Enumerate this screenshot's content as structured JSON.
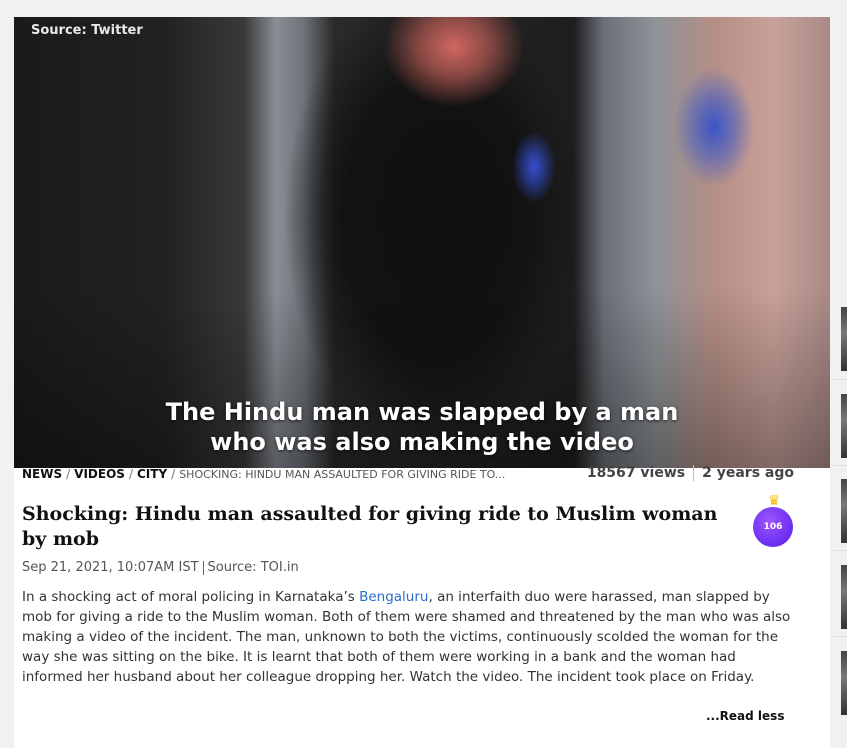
{
  "video": {
    "source_label": "Source: Twitter",
    "caption_line1": "The Hindu man was slapped by a man",
    "caption_line2": "who was also making the video"
  },
  "breadcrumb": {
    "items": [
      "NEWS",
      "VIDEOS",
      "CITY"
    ],
    "separator": "/",
    "current": "SHOCKING: HINDU MAN ASSAULTED FOR GIVING RIDE TO..."
  },
  "stats": {
    "views": "18567 views",
    "age": "2 years ago"
  },
  "article": {
    "title": "Shocking: Hindu man assaulted for giving ride to Muslim woman by mob",
    "badge_count": "106",
    "date": "Sep 21, 2021, 10:07AM IST",
    "source": "Source: TOI.in",
    "body_before_link": "In a shocking act of moral policing in Karnataka’s ",
    "body_link": "Bengaluru",
    "body_after_link": ", an interfaith duo were harassed, man slapped by mob for giving a ride to the Muslim woman. Both of them were shamed and threatened by the man who was also making a video of the incident. The man, unknown to both the victims, continuously scolded the woman for the way she was sitting on the bike. It is learnt that both of them were working in a bank and the woman had informed her husband about her colleague dropping her. Watch the video. The incident took place on Friday.",
    "read_less": "...Read less"
  },
  "icons": {
    "crown": "crown-icon"
  },
  "colors": {
    "link": "#2a6ccf",
    "badge": "#6a2cf0",
    "crown": "#f5b800"
  }
}
